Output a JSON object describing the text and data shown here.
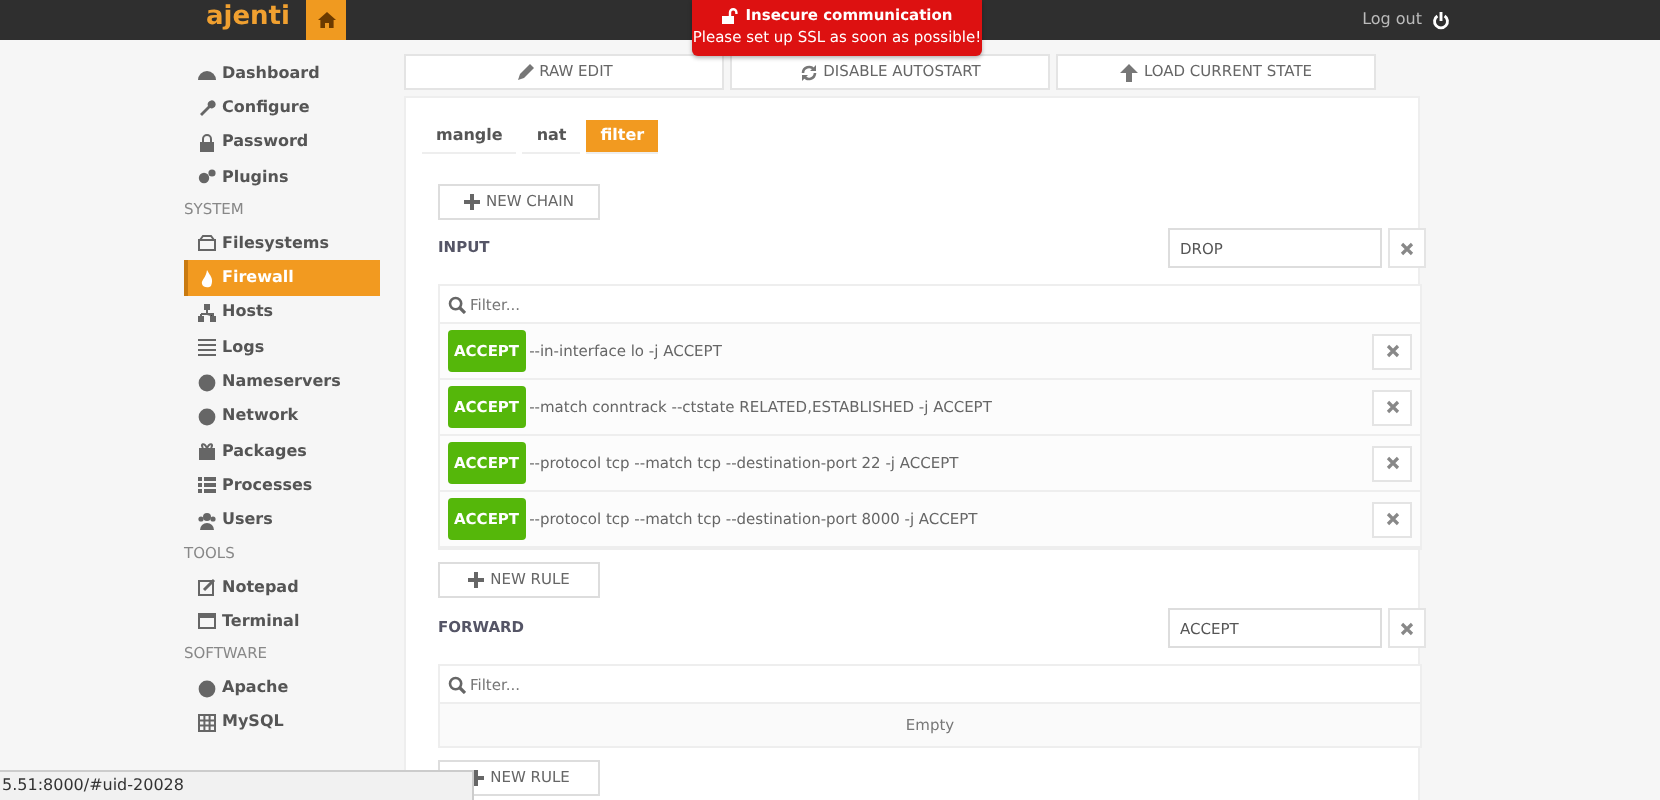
{
  "navbar": {
    "logo": "ajenti",
    "logout": "Log out"
  },
  "alert": {
    "title": "Insecure communication",
    "message": "Please set up SSL as soon as possible!"
  },
  "sidebar": [
    {
      "kind": "item",
      "label": "Dashboard",
      "selected": false
    },
    {
      "kind": "item",
      "label": "Configure",
      "selected": false
    },
    {
      "kind": "item",
      "label": "Password",
      "selected": false
    },
    {
      "kind": "item",
      "label": "Plugins",
      "selected": false
    },
    {
      "kind": "section",
      "label": "SYSTEM"
    },
    {
      "kind": "item",
      "label": "Filesystems",
      "selected": false
    },
    {
      "kind": "item",
      "label": "Firewall",
      "selected": true
    },
    {
      "kind": "item",
      "label": "Hosts",
      "selected": false
    },
    {
      "kind": "item",
      "label": "Logs",
      "selected": false
    },
    {
      "kind": "item",
      "label": "Nameservers",
      "selected": false
    },
    {
      "kind": "item",
      "label": "Network",
      "selected": false
    },
    {
      "kind": "item",
      "label": "Packages",
      "selected": false
    },
    {
      "kind": "item",
      "label": "Processes",
      "selected": false
    },
    {
      "kind": "item",
      "label": "Users",
      "selected": false
    },
    {
      "kind": "section",
      "label": "TOOLS"
    },
    {
      "kind": "item",
      "label": "Notepad",
      "selected": false
    },
    {
      "kind": "item",
      "label": "Terminal",
      "selected": false
    },
    {
      "kind": "section",
      "label": "SOFTWARE"
    },
    {
      "kind": "item",
      "label": "Apache",
      "selected": false
    },
    {
      "kind": "item",
      "label": "MySQL",
      "selected": false
    }
  ],
  "toolbar": [
    "RAW EDIT",
    "DISABLE AUTOSTART",
    "LOAD CURRENT STATE"
  ],
  "tables": [
    {
      "label": "mangle",
      "selected": false
    },
    {
      "label": "nat",
      "selected": false
    },
    {
      "label": "filter",
      "selected": true
    }
  ],
  "new_chain": "NEW CHAIN",
  "chains": [
    {
      "name": "INPUT",
      "policy": "DROP",
      "filter_placeholder": "Filter...",
      "new_rule": "NEW RULE",
      "rules": [
        {
          "action": "ACCEPT",
          "text": "--in-interface lo -j ACCEPT"
        },
        {
          "action": "ACCEPT",
          "text": "--match conntrack --ctstate RELATED,ESTABLISHED -j ACCEPT"
        },
        {
          "action": "ACCEPT",
          "text": "--protocol tcp --match tcp --destination-port 22 -j ACCEPT"
        },
        {
          "action": "ACCEPT",
          "text": "--protocol tcp --match tcp --destination-port 8000 -j ACCEPT"
        }
      ]
    },
    {
      "name": "FORWARD",
      "policy": "ACCEPT",
      "filter_placeholder": "Filter...",
      "new_rule": "NEW RULE",
      "empty_text": "Empty"
    }
  ],
  "status_url": "5.51:8000/#uid-20028"
}
